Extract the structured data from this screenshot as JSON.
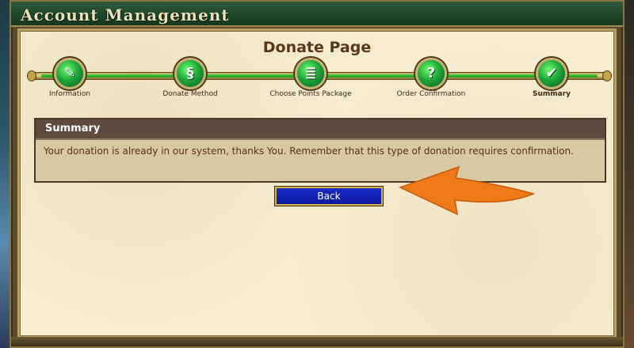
{
  "window": {
    "title": "Account Management"
  },
  "page": {
    "title": "Donate Page"
  },
  "steps": [
    {
      "label": "Information",
      "icon": "quill-icon",
      "glyph": "✎"
    },
    {
      "label": "Donate Method",
      "icon": "scroll-icon",
      "glyph": "§"
    },
    {
      "label": "Choose Points Package",
      "icon": "list-scroll-icon",
      "glyph": "≣"
    },
    {
      "label": "Order Confirmation",
      "icon": "question-icon",
      "glyph": "?"
    },
    {
      "label": "Summary",
      "icon": "checkmark-icon",
      "glyph": "✔"
    }
  ],
  "summary": {
    "header": "Summary",
    "message": "Your donation is already in our system, thanks You. Remember that this type of donation requires confirmation."
  },
  "actions": {
    "back_label": "Back"
  },
  "colors": {
    "accent_green": "#1fa83a",
    "button_blue": "#0a1aa0",
    "arrow_orange": "#f07a18"
  }
}
